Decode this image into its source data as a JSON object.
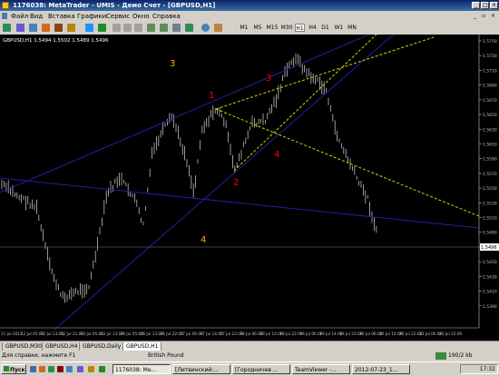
{
  "window": {
    "title": "1176038: MetaTrader - UMIS - Демо Счет - [GBPUSD,H1]"
  },
  "menu": [
    "Файл",
    "Вид",
    "Вставка",
    "Графики",
    "Сервис",
    "Окно",
    "Справка"
  ],
  "toolbar": {
    "timeframes": [
      "M1",
      "M5",
      "M15",
      "M30",
      "H1",
      "H4",
      "D1",
      "W1",
      "MN"
    ],
    "active_timeframe": "H1"
  },
  "chart": {
    "header": "GBPUSD,H1  1.5494 1.5502 1.5489 1.5496",
    "current_price": "1.5496",
    "price_ticks": [
      "1.5750",
      "1.5730",
      "1.5710",
      "1.5690",
      "1.5670",
      "1.5650",
      "1.5630",
      "1.5610",
      "1.5590",
      "1.5570",
      "1.5550",
      "1.5530",
      "1.5510",
      "1.5490",
      "1.5470",
      "1.5450",
      "1.5430",
      "1.5410",
      "1.5390"
    ],
    "time_ticks": [
      "11 Jul 2012",
      "12 Jul 05:00",
      "12 Jul 13:00",
      "12 Jul 21:00",
      "13 Jul 05:00",
      "13 Jul 13:00",
      "16 Jul 05:00",
      "16 Jul 13:00",
      "16 Jul 22:00",
      "17 Jul 06:00",
      "17 Jul 14:00",
      "17 Jul 22:00",
      "18 Jul 06:00",
      "18 Jul 14:00",
      "18 Jul 22:00",
      "19 Jul 06:00",
      "19 Jul 14:00",
      "19 Jul 22:00",
      "20 Jul 06:00",
      "20 Jul 14:00",
      "20 Jul 22:00",
      "23 Jul 06:00",
      "23 Jul 15:00"
    ],
    "labels": {
      "l1": "1",
      "l2": "2",
      "l3_red": "3",
      "l4_red": "4",
      "l3_orange": "3",
      "l4_orange": "4"
    },
    "colors": {
      "background": "#000000",
      "bars": "#c0c0c0",
      "channel": "#2020a0",
      "fan": "#d4d400",
      "red_label": "#ff0000",
      "orange_label": "#ffa500"
    }
  },
  "tabs": [
    "GBPUSD,M30",
    "GBPUSD,H4",
    "GBPUSD,Daily",
    "GBPUSD,H1"
  ],
  "active_tab": "GBPUSD,H1",
  "status": {
    "help": "Для справки, нажмите F1",
    "profile": "British Pound",
    "traffic": "190/2 kb"
  },
  "taskbar": {
    "start": "Пуск",
    "items": [
      "1176038: Me...",
      "[Литвинский:...",
      "[Городничев ...",
      "TeamViewer -...",
      "2012-07-23_1..."
    ],
    "clock": "17:32"
  }
}
